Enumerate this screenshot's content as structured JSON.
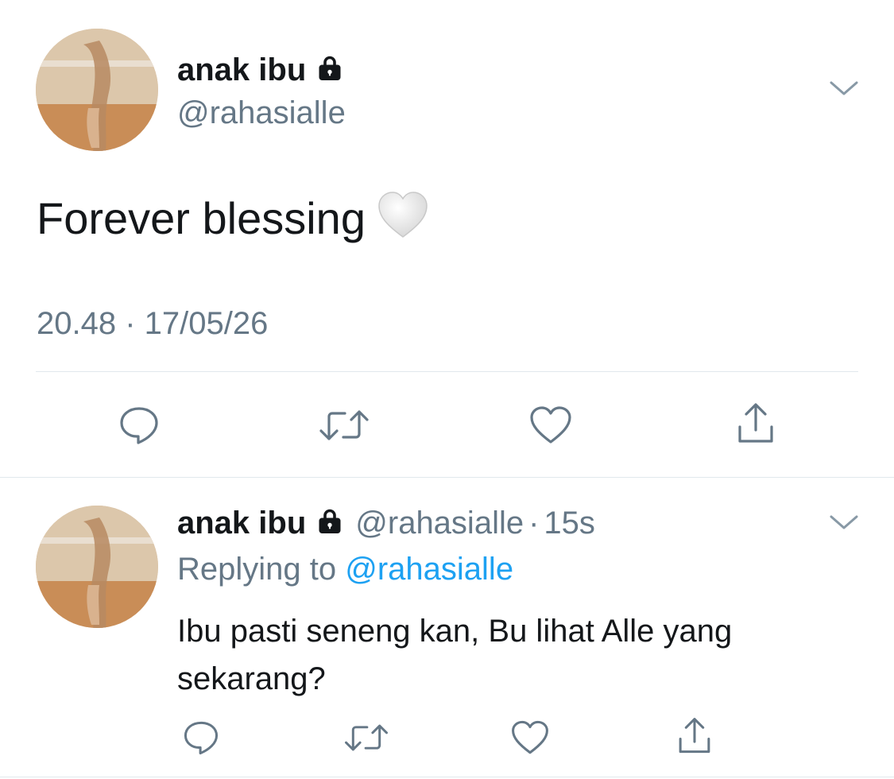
{
  "main_tweet": {
    "display_name": "anak ibu",
    "handle": "@rahasialle",
    "text": "Forever blessing",
    "emoji_icon": "white-heart-emoji",
    "timestamp": "20.48 · 17/05/26",
    "icons": [
      "lock-icon",
      "chevron-down-icon",
      "reply-icon",
      "retweet-icon",
      "like-icon",
      "share-icon"
    ]
  },
  "reply_tweet": {
    "display_name": "anak ibu",
    "handle": "@rahasialle",
    "separator": "·",
    "time": "15s",
    "replying_label": "Replying to",
    "replying_to": "@rahasialle",
    "text": "Ibu pasti seneng kan, Bu lihat Alle yang sekarang?"
  },
  "colors": {
    "primary_text": "#14171a",
    "secondary_text": "#657786",
    "link": "#1da1f2",
    "divider": "#e1e8ed"
  }
}
